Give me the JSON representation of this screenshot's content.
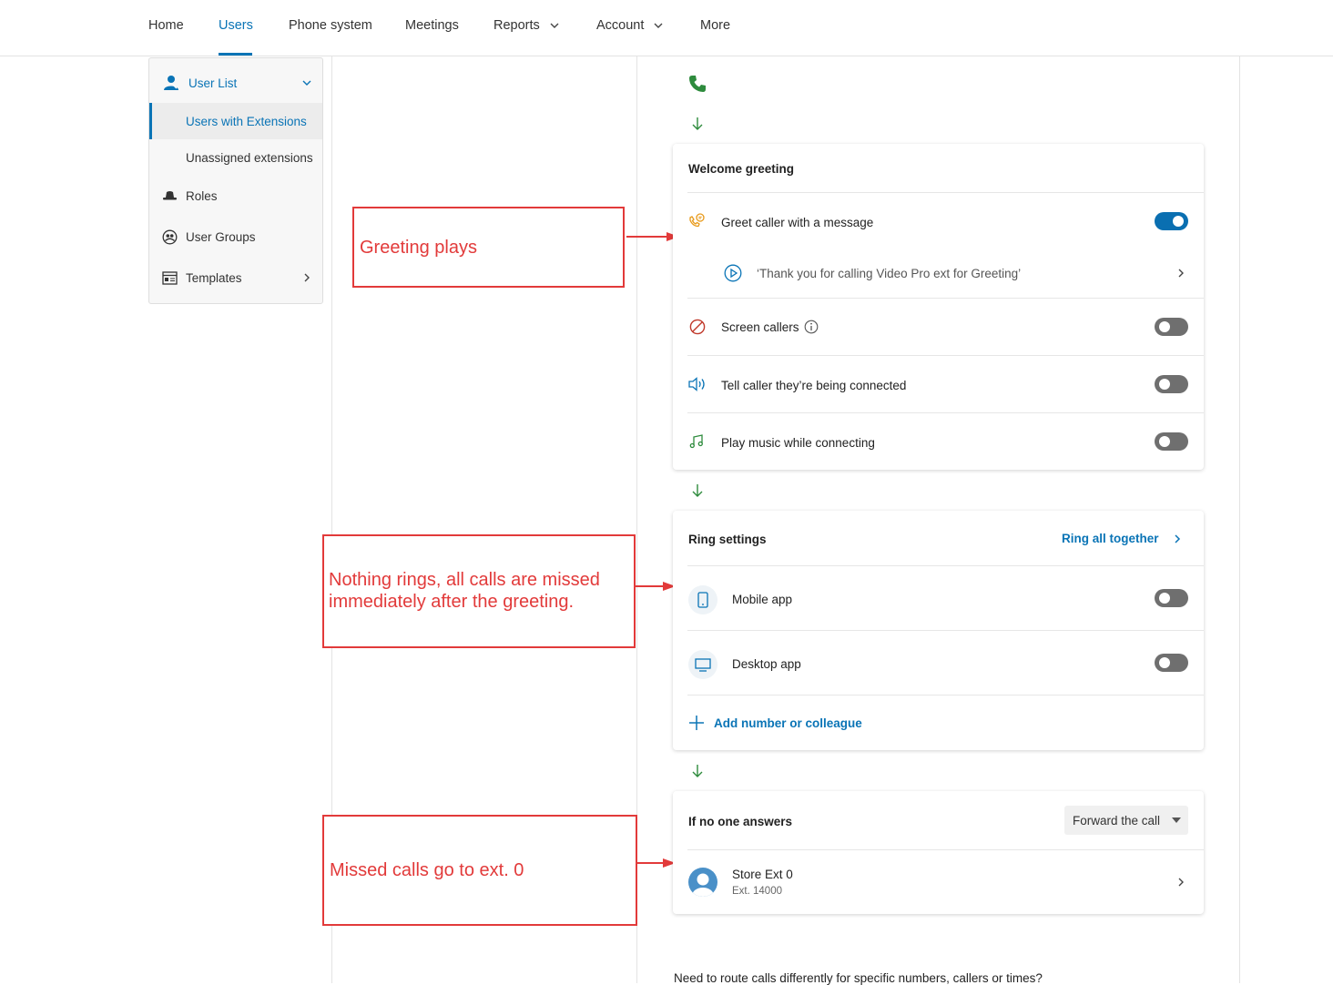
{
  "nav": {
    "items": [
      "Home",
      "Users",
      "Phone system",
      "Meetings",
      "Reports",
      "Account",
      "More"
    ],
    "active": "Users"
  },
  "sidebar": {
    "user_list": "User List",
    "users_with_extensions": "Users with Extensions",
    "unassigned_extensions": "Unassigned extensions",
    "roles": "Roles",
    "user_groups": "User Groups",
    "templates": "Templates"
  },
  "annotations": {
    "greeting": "Greeting plays",
    "nothing_rings_1": "Nothing rings, all calls are missed",
    "nothing_rings_2": "immediately after the greeting.",
    "missed": "Missed calls go to ext. 0"
  },
  "welcome": {
    "title": "Welcome greeting",
    "greet_label": "Greet caller with a message",
    "greet_on": true,
    "message": "‘Thank you for calling Video Pro ext for Greeting’",
    "screen_label": "Screen callers",
    "screen_on": false,
    "tell_label": "Tell caller they’re being connected",
    "tell_on": false,
    "music_label": "Play music while connecting",
    "music_on": false
  },
  "ring": {
    "title": "Ring settings",
    "mode": "Ring all together",
    "mobile_label": "Mobile app",
    "mobile_on": false,
    "desktop_label": "Desktop app",
    "desktop_on": false,
    "add_label": "Add number or colleague"
  },
  "no_answer": {
    "title": "If no one answers",
    "action": "Forward the call",
    "target_name": "Store Ext 0",
    "target_ext": "Ext. 14000"
  },
  "footer_text": "Need to route calls differently for specific numbers, callers or times?",
  "colors": {
    "brand_blue": "#0a74b6",
    "annotation_red": "#e23a3a",
    "flow_green": "#2e8b3d"
  }
}
